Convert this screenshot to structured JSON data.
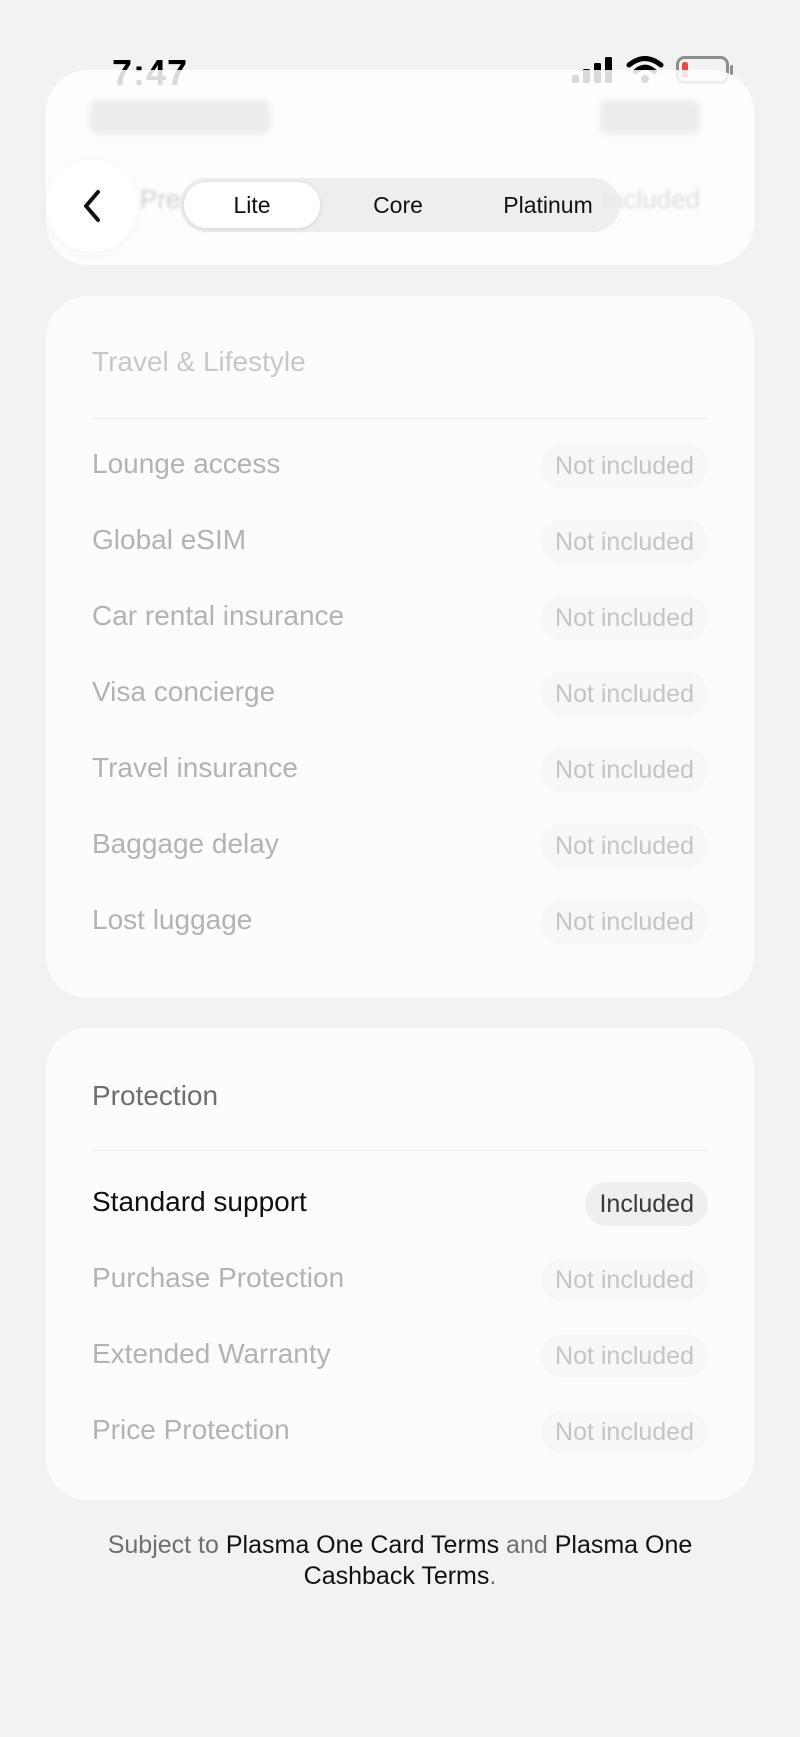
{
  "status_bar": {
    "time": "7:47"
  },
  "header": {
    "background_row_left": "Premium",
    "background_row_right": "Included",
    "tabs": [
      {
        "label": "Lite",
        "selected": true
      },
      {
        "label": "Core",
        "selected": false
      },
      {
        "label": "Platinum",
        "selected": false
      }
    ]
  },
  "travel": {
    "title": "Travel & Lifestyle",
    "rows": [
      {
        "label": "Lounge access",
        "value": "Not included"
      },
      {
        "label": "Global eSIM",
        "value": "Not included"
      },
      {
        "label": "Car rental insurance",
        "value": "Not included"
      },
      {
        "label": "Visa concierge",
        "value": "Not included"
      },
      {
        "label": "Travel insurance",
        "value": "Not included"
      },
      {
        "label": "Baggage delay",
        "value": "Not included"
      },
      {
        "label": "Lost luggage",
        "value": "Not included"
      }
    ]
  },
  "protection": {
    "title": "Protection",
    "rows": [
      {
        "label": "Standard support",
        "value": "Included"
      },
      {
        "label": "Purchase Protection",
        "value": "Not included"
      },
      {
        "label": "Extended Warranty",
        "value": "Not included"
      },
      {
        "label": "Price Protection",
        "value": "Not included"
      }
    ]
  },
  "footer": {
    "prefix": "Subject to ",
    "link1": "Plasma One Card Terms",
    "middle": " and ",
    "link2": "Plasma One Cashback Terms",
    "suffix": "."
  },
  "colors": {
    "background": "#f2f2f2",
    "card": "#fcfcfc",
    "battery_low": "#e5484d"
  }
}
